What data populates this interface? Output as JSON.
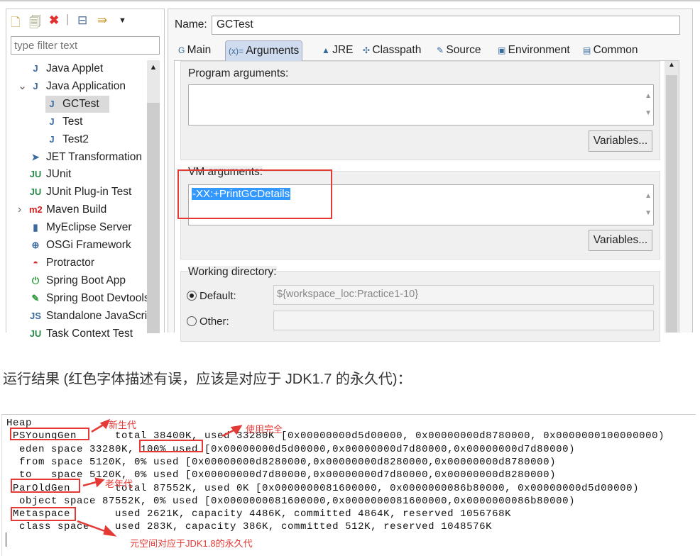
{
  "toolbar": {
    "icons": [
      "new-config-icon",
      "duplicate-icon",
      "delete-icon",
      "collapse-all-icon",
      "filter-icon",
      "dropdown-icon"
    ]
  },
  "filter": {
    "placeholder": "type filter text"
  },
  "tree": [
    {
      "label": "Java Applet",
      "icon": "J",
      "indent": 0
    },
    {
      "label": "Java Application",
      "icon": "J",
      "indent": 0,
      "expanded": true
    },
    {
      "label": "GCTest",
      "icon": "J",
      "indent": 1,
      "selected": true
    },
    {
      "label": "Test",
      "icon": "J",
      "indent": 1
    },
    {
      "label": "Test2",
      "icon": "J",
      "indent": 1
    },
    {
      "label": "JET Transformation",
      "icon": "➤",
      "indent": 0
    },
    {
      "label": "JUnit",
      "icon": "JU",
      "indent": 0
    },
    {
      "label": "JUnit Plug-in Test",
      "icon": "JU",
      "indent": 0
    },
    {
      "label": "Maven Build",
      "icon": "m2",
      "indent": 0,
      "collapsed": true
    },
    {
      "label": "MyEclipse Server",
      "icon": "▮",
      "indent": 0
    },
    {
      "label": "OSGi Framework",
      "icon": "⊕",
      "indent": 0
    },
    {
      "label": "Protractor",
      "icon": "◓",
      "indent": 0
    },
    {
      "label": "Spring Boot App",
      "icon": "⏻",
      "indent": 0
    },
    {
      "label": "Spring Boot Devtools",
      "icon": "✎",
      "indent": 0
    },
    {
      "label": "Standalone JavaScript",
      "icon": "JS",
      "indent": 0
    },
    {
      "label": "Task Context Test",
      "icon": "JU",
      "indent": 0
    }
  ],
  "name": {
    "label": "Name:",
    "value": "GCTest"
  },
  "tabs": [
    {
      "label": "Main",
      "icon": "G"
    },
    {
      "label": "Arguments",
      "icon": "(x)="
    },
    {
      "label": "JRE",
      "icon": "▲"
    },
    {
      "label": "Classpath",
      "icon": "✣"
    },
    {
      "label": "Source",
      "icon": "✎"
    },
    {
      "label": "Environment",
      "icon": "▣"
    },
    {
      "label": "Common",
      "icon": "▤"
    }
  ],
  "program_args": {
    "label": "Program arguments:",
    "value": "",
    "variables": "Variables..."
  },
  "vm_args": {
    "label": "VM arguments:",
    "value": "-XX:+PrintGCDetails",
    "variables": "Variables..."
  },
  "workdir": {
    "label": "Working directory:",
    "default_label": "Default:",
    "default_value": "${workspace_loc:Practice1-10}",
    "other_label": "Other:",
    "other_value": ""
  },
  "caption": "运行结果 (红色字体描述有误，应该是对应于 JDK1.7 的永久代)：",
  "console": [
    "Heap",
    " PSYoungGen      total 38400K, used 33280K [0x00000000d5d00000, 0x00000000d8780000, 0x0000000100000000)",
    "  eden space 33280K, 100% used [0x00000000d5d00000,0x00000000d7d80000,0x00000000d7d80000)",
    "  from space 5120K, 0% used [0x00000000d8280000,0x00000000d8280000,0x00000000d8780000)",
    "  to   space 5120K, 0% used [0x00000000d7d80000,0x00000000d7d80000,0x00000000d8280000)",
    " ParOldGen       total 87552K, used 0K [0x0000000081600000, 0x0000000086b80000, 0x00000000d5d00000)",
    "  object space 87552K, 0% used [0x0000000081600000,0x0000000081600000,0x0000000086b80000)",
    " Metaspace       used 2621K, capacity 4486K, committed 4864K, reserved 1056768K",
    "  class space    used 283K, capacity 386K, committed 512K, reserved 1048576K"
  ],
  "annotations": {
    "young": "新生代",
    "full": "使用完全",
    "old": "老年代",
    "meta": "元空间对应于JDK1.8的永久代"
  },
  "colors": {
    "annotation": "#e53935",
    "selection": "#3399ff",
    "tab_active": "#cfdcef"
  }
}
